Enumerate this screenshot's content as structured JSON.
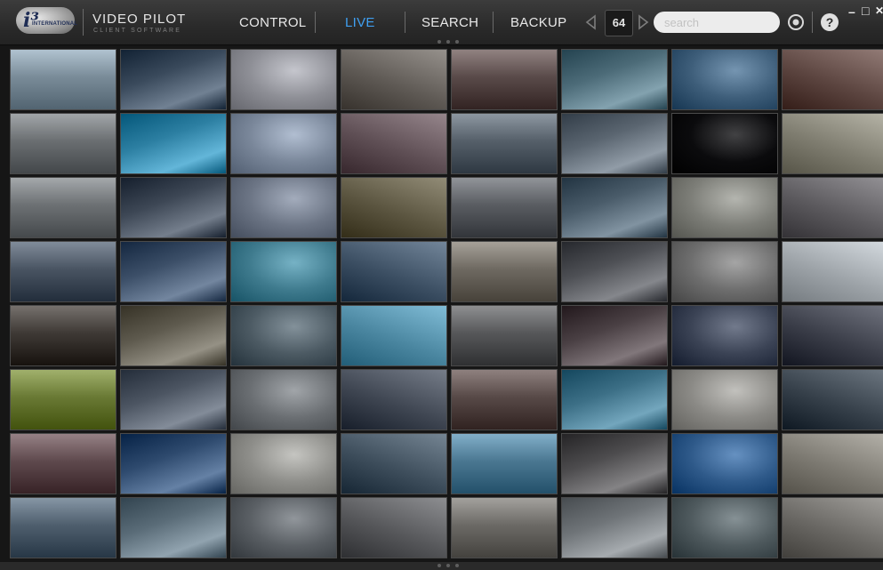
{
  "app": {
    "brand_title": "VIDEO PILOT",
    "brand_subtitle": "CLIENT SOFTWARE",
    "logo_text": "INTERNATIONAL"
  },
  "nav": {
    "control": "CONTROL",
    "live": "LIVE",
    "search": "SEARCH",
    "backup": "BACKUP"
  },
  "toolbar": {
    "camera_count": "64",
    "search_placeholder": "search",
    "help_label": "?",
    "minimize_label": "–",
    "maximize_label": "□",
    "close_label": "✕"
  },
  "colors": {
    "accent": "#3f9ff0",
    "nav_text": "#e8e8e8",
    "toolbar_bg": "#2d2d2d"
  },
  "grid": {
    "rows": 8,
    "columns": 8,
    "tiles": [
      [
        "#7a8c99",
        "#3a4a5c",
        "#8e8f96",
        "#5f5a55",
        "#5a4b4a",
        "#4c6b78",
        "#3e5e7a",
        "#5c4540"
      ],
      [
        "#6b6f72",
        "#2c7fa2",
        "#7a879a",
        "#5f4f55",
        "#56606a",
        "#5a6570",
        "#0b0b0d",
        "#7f7d70"
      ],
      [
        "#6d7174",
        "#3d4755",
        "#6c7585",
        "#5b5540",
        "#5a5d62",
        "#4a5c6a",
        "#7d7e78",
        "#5c5a5e"
      ],
      [
        "#4a5563",
        "#3c4f68",
        "#3f7b8e",
        "#3c4f63",
        "#6f6a62",
        "#4e5055",
        "#6e6e6e",
        "#9da3a8"
      ],
      [
        "#3f3a36",
        "#5e5a4e",
        "#4c5a63",
        "#4a86a0",
        "#57585a",
        "#4a4044",
        "#3b4355",
        "#3a3d48"
      ],
      [
        "#6a7a35",
        "#4c5562",
        "#6a6e72",
        "#3f4652",
        "#584a48",
        "#3c6f86",
        "#8b8a86",
        "#36404a"
      ],
      [
        "#5f4a4e",
        "#2e4a6e",
        "#8e8e8a",
        "#3e4e5c",
        "#4b7892",
        "#4d4c4e",
        "#2f5a8a",
        "#7d7a72"
      ],
      [
        "#4f5f6e",
        "#5a6c78",
        "#5a5f64",
        "#56575a",
        "#6c6a66",
        "#6f7478",
        "#4f5a5e",
        "#6a6864"
      ]
    ]
  }
}
